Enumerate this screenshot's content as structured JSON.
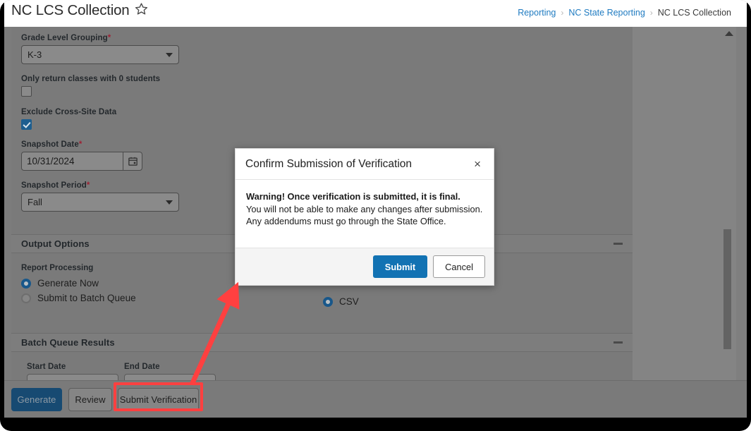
{
  "header": {
    "page_title": "NC LCS Collection",
    "favorite_icon": "star-outline-icon",
    "breadcrumb": [
      {
        "label": "Reporting",
        "current": false
      },
      {
        "label": "NC State Reporting",
        "current": false
      },
      {
        "label": "NC LCS Collection",
        "current": true
      }
    ],
    "breadcrumb_separator": "›"
  },
  "form": {
    "grade_level_grouping": {
      "label": "Grade Level Grouping",
      "required_marker": "*",
      "value": "K-3"
    },
    "only_return_zero": {
      "label": "Only return classes with 0 students",
      "checked": false
    },
    "exclude_cross_site": {
      "label": "Exclude Cross-Site Data",
      "checked": true
    },
    "snapshot_date": {
      "label": "Snapshot Date",
      "required_marker": "*",
      "value": "10/31/2024",
      "icon": "calendar-icon"
    },
    "snapshot_period": {
      "label": "Snapshot Period",
      "required_marker": "*",
      "value": "Fall"
    }
  },
  "output_options": {
    "section_title": "Output Options",
    "collapse_icon": "minus-icon",
    "report_processing": {
      "label": "Report Processing",
      "options": [
        {
          "label": "Generate Now",
          "selected": true
        },
        {
          "label": "Submit to Batch Queue",
          "selected": false
        }
      ]
    },
    "format": {
      "options": [
        {
          "label": "CSV",
          "selected": true
        }
      ]
    }
  },
  "batch_queue_results": {
    "section_title": "Batch Queue Results",
    "collapse_icon": "minus-icon",
    "columns": [
      {
        "label": "Start Date"
      },
      {
        "label": "End Date"
      }
    ]
  },
  "footer": {
    "buttons": [
      {
        "label": "Generate",
        "style": "primary",
        "highlighted": false
      },
      {
        "label": "Review",
        "style": "plain",
        "highlighted": false
      },
      {
        "label": "Submit Verification",
        "style": "plain",
        "highlighted": true
      }
    ]
  },
  "modal": {
    "title": "Confirm Submission of Verification",
    "close_icon": "close-icon",
    "close_label": "×",
    "warning": "Warning! Once verification is submitted, it is final.",
    "body_lines": [
      "You will not be able to make any changes after submission.",
      "Any addendums must go through the State Office."
    ],
    "submit_label": "Submit",
    "cancel_label": "Cancel"
  },
  "annotation": {
    "arrow_color": "#ff4040",
    "highlight_color": "#ff4040",
    "highlight_target": "Submit Verification"
  },
  "colors": {
    "accent_blue": "#1272b3",
    "link_blue": "#1f7bc1",
    "primary_button": "#174a72",
    "required_red": "#9d2235",
    "dim_overlay": "#7a7a7a",
    "annotation_red": "#ff4040"
  },
  "scrollbar": {
    "up_arrow_icon": "chevron-up-icon"
  }
}
